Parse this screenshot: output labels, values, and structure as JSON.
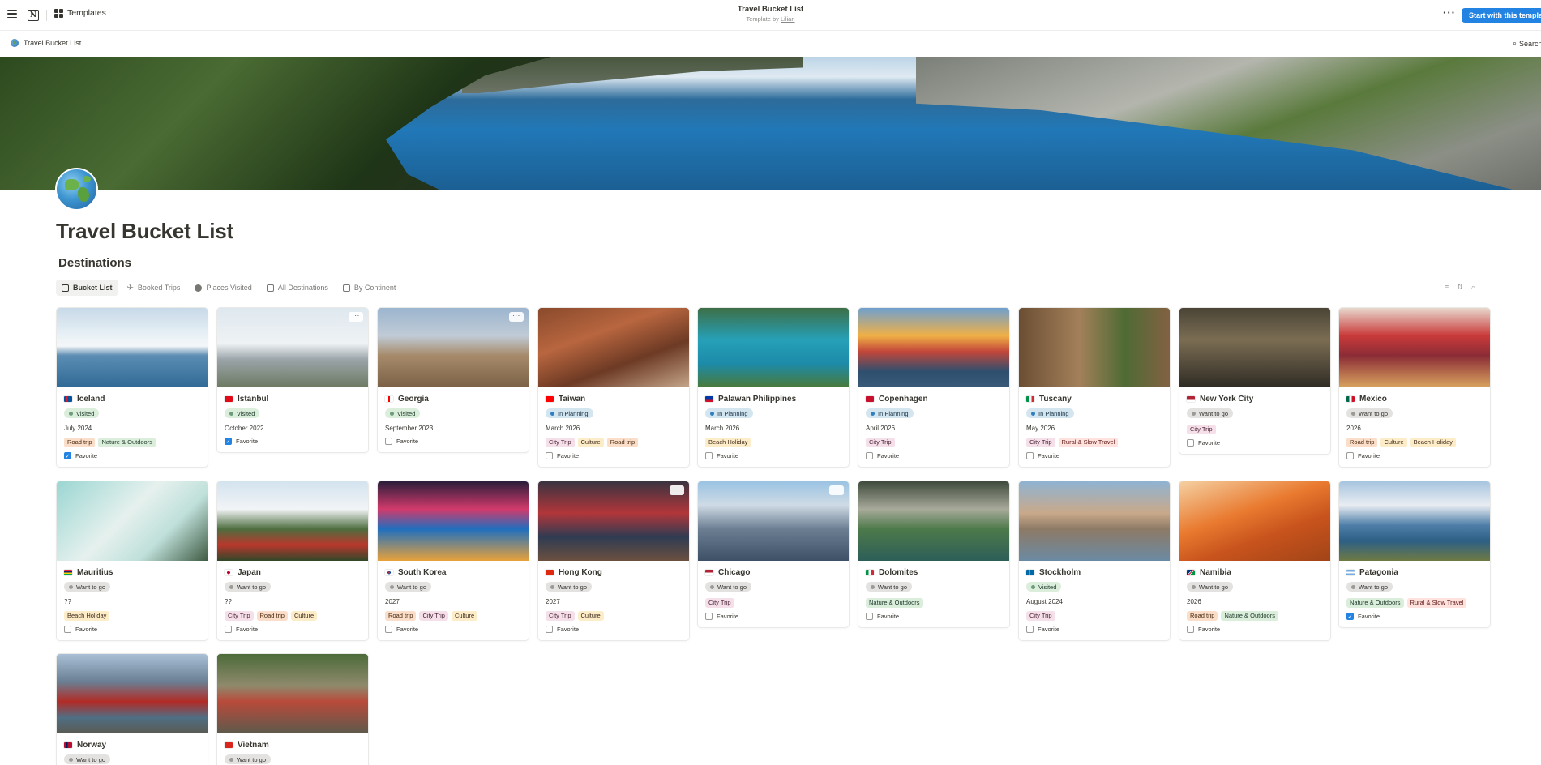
{
  "topbar": {
    "templates_label": "Templates",
    "title": "Travel Bucket List",
    "subtitle_prefix": "Template by",
    "author": "Lilian",
    "more_label": "···",
    "start_button": "Start with this template"
  },
  "breadcrumb": {
    "page": "Travel Bucket List",
    "search": "Search"
  },
  "page": {
    "title": "Travel Bucket List",
    "section": "Destinations"
  },
  "tabs": [
    {
      "label": "Bucket List",
      "icon": "gallery-icon"
    },
    {
      "label": "Booked Trips",
      "icon": "plane-icon"
    },
    {
      "label": "Places Visited",
      "icon": "check-circle-icon"
    },
    {
      "label": "All Destinations",
      "icon": "table-icon"
    },
    {
      "label": "By Continent",
      "icon": "board-icon"
    }
  ],
  "favorite_label": "Favorite",
  "cards": [
    {
      "name": "Iceland",
      "status": "Visited",
      "status_kind": "visited",
      "date": "July 2024",
      "tags": [
        [
          "Road trip",
          "road"
        ],
        [
          "Nature & Outdoors",
          "nature"
        ]
      ],
      "favorite": true
    },
    {
      "name": "Istanbul",
      "status": "Visited",
      "status_kind": "visited",
      "date": "October 2022",
      "tags": [],
      "favorite": true
    },
    {
      "name": "Georgia",
      "status": "Visited",
      "status_kind": "visited",
      "date": "September 2023",
      "tags": [],
      "favorite": false
    },
    {
      "name": "Taiwan",
      "status": "In Planning",
      "status_kind": "planning",
      "date": "March 2026",
      "tags": [
        [
          "City Trip",
          "city"
        ],
        [
          "Culture",
          "culture"
        ],
        [
          "Road trip",
          "road"
        ]
      ],
      "favorite": false
    },
    {
      "name": "Palawan Philippines",
      "status": "In Planning",
      "status_kind": "planning",
      "date": "March 2026",
      "tags": [
        [
          "Beach Holiday",
          "beach"
        ]
      ],
      "favorite": false
    },
    {
      "name": "Copenhagen",
      "status": "In Planning",
      "status_kind": "planning",
      "date": "April 2026",
      "tags": [
        [
          "City Trip",
          "city"
        ]
      ],
      "favorite": false
    },
    {
      "name": "Tuscany",
      "status": "In Planning",
      "status_kind": "planning",
      "date": "May 2026",
      "tags": [
        [
          "City Trip",
          "city"
        ],
        [
          "Rural & Slow Travel",
          "rural"
        ]
      ],
      "favorite": false
    },
    {
      "name": "New York City",
      "status": "Want to go",
      "status_kind": "want",
      "date": "",
      "tags": [
        [
          "City Trip",
          "city"
        ]
      ],
      "favorite": false
    },
    {
      "name": "Mexico",
      "status": "Want to go",
      "status_kind": "want",
      "date": "2026",
      "tags": [
        [
          "Road trip",
          "road"
        ],
        [
          "Culture",
          "culture"
        ],
        [
          "Beach Holiday",
          "beach"
        ]
      ],
      "favorite": false
    },
    {
      "name": "Mauritius",
      "status": "Want to go",
      "status_kind": "want",
      "date": "??",
      "tags": [
        [
          "Beach Holiday",
          "beach"
        ]
      ],
      "favorite": false
    },
    {
      "name": "Japan",
      "status": "Want to go",
      "status_kind": "want",
      "date": "??",
      "tags": [
        [
          "City Trip",
          "city"
        ],
        [
          "Road trip",
          "road"
        ],
        [
          "Culture",
          "culture"
        ]
      ],
      "favorite": false
    },
    {
      "name": "South Korea",
      "status": "Want to go",
      "status_kind": "want",
      "date": "2027",
      "tags": [
        [
          "Road trip",
          "road"
        ],
        [
          "City Trip",
          "city"
        ],
        [
          "Culture",
          "culture"
        ]
      ],
      "favorite": false
    },
    {
      "name": "Hong Kong",
      "status": "Want to go",
      "status_kind": "want",
      "date": "2027",
      "tags": [
        [
          "City Trip",
          "city"
        ],
        [
          "Culture",
          "culture"
        ]
      ],
      "favorite": false
    },
    {
      "name": "Chicago",
      "status": "Want to go",
      "status_kind": "want",
      "date": "",
      "tags": [
        [
          "City Trip",
          "city"
        ]
      ],
      "favorite": false
    },
    {
      "name": "Dolomites",
      "status": "Want to go",
      "status_kind": "want",
      "date": "",
      "tags": [
        [
          "Nature & Outdoors",
          "nature"
        ]
      ],
      "favorite": false
    },
    {
      "name": "Stockholm",
      "status": "Visited",
      "status_kind": "visited",
      "date": "August 2024",
      "tags": [
        [
          "City Trip",
          "city"
        ]
      ],
      "favorite": false
    },
    {
      "name": "Namibia",
      "status": "Want to go",
      "status_kind": "want",
      "date": "2026",
      "tags": [
        [
          "Road trip",
          "road"
        ],
        [
          "Nature & Outdoors",
          "nature"
        ]
      ],
      "favorite": false
    },
    {
      "name": "Patagonia",
      "status": "Want to go",
      "status_kind": "want",
      "date": "",
      "tags": [
        [
          "Nature & Outdoors",
          "nature"
        ],
        [
          "Rural & Slow Travel",
          "rural"
        ]
      ],
      "favorite": true
    },
    {
      "name": "Norway",
      "status": "Want to go",
      "status_kind": "want",
      "date": "",
      "tags": [],
      "favorite": false
    },
    {
      "name": "Vietnam",
      "status": "Want to go",
      "status_kind": "want",
      "date": "",
      "tags": [],
      "favorite": false
    }
  ]
}
